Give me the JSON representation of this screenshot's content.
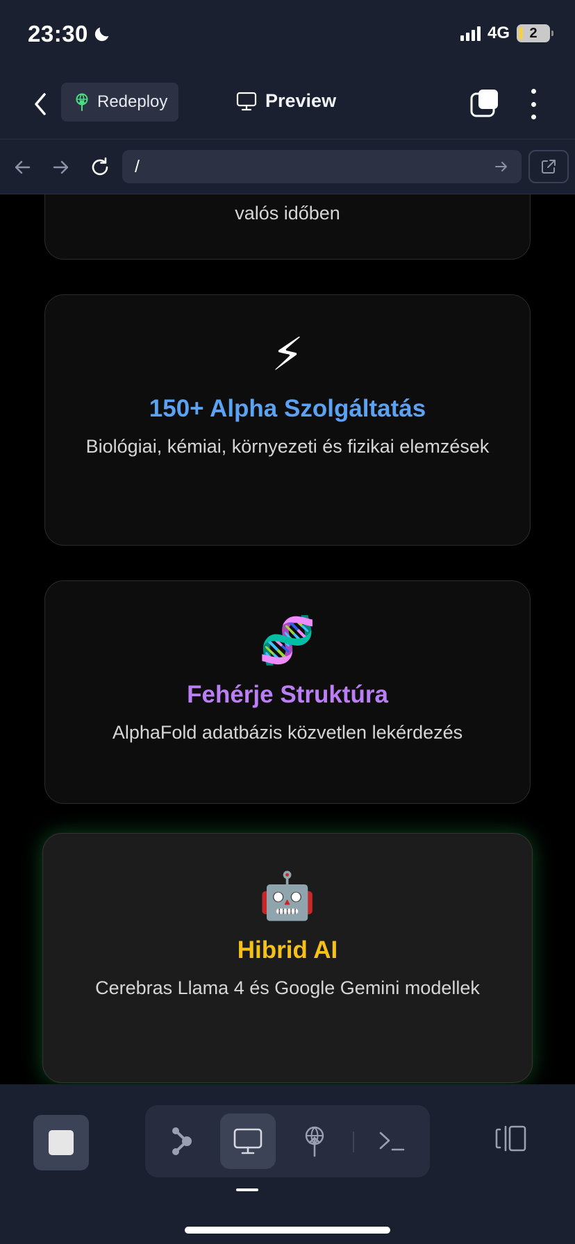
{
  "status_bar": {
    "time": "23:30",
    "network": "4G",
    "battery_label": "2"
  },
  "nav": {
    "redeploy_label": "Redeploy",
    "title": "Preview"
  },
  "url_bar": {
    "url": "/"
  },
  "cards": [
    {
      "emoji": "",
      "title": "",
      "description": "valós időben",
      "title_color": ""
    },
    {
      "emoji": "⚡",
      "title": "150+ Alpha Szolgáltatás",
      "description": "Biológiai, kémiai, környezeti és fizikai elemzések",
      "title_color": "#5ba2f2"
    },
    {
      "emoji": "🧬",
      "title": "Fehérje Struktúra",
      "description": "AlphaFold adatbázis közvetlen lekérdezés",
      "title_color": "#bb7ef5"
    },
    {
      "emoji": "🤖",
      "title": "Hibrid AI",
      "description": "Cerebras Llama 4 és Google Gemini modellek",
      "title_color": "#f5c018"
    }
  ],
  "icons": {
    "back": "chevron-left-icon",
    "redeploy": "deploy-icon",
    "preview": "monitor-icon",
    "tabs": "tabs-icon",
    "more": "more-vertical-icon",
    "nav_back": "arrow-left-icon",
    "nav_forward": "arrow-right-icon",
    "reload": "reload-icon",
    "go": "arrow-right-icon",
    "open_external": "external-link-icon",
    "stop": "stop-icon",
    "workflow": "workflow-icon",
    "monitor": "monitor-icon",
    "deploy": "deploy-icon",
    "terminal": "terminal-icon",
    "layout": "split-layout-icon"
  }
}
